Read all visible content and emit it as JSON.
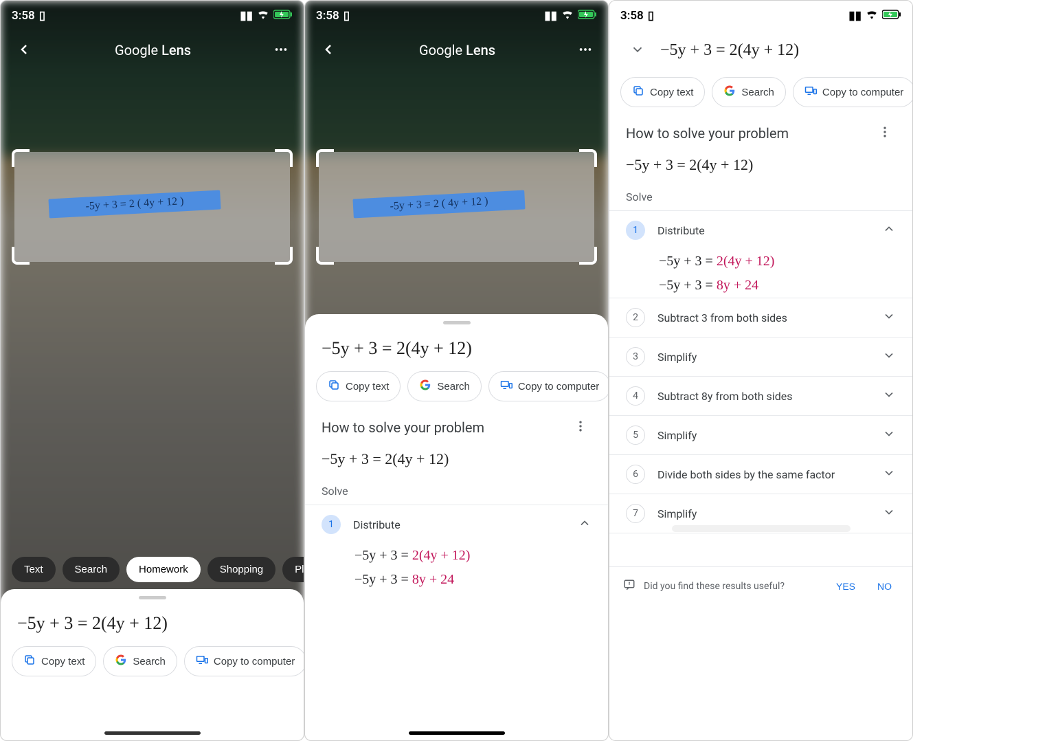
{
  "status": {
    "time": "3:58"
  },
  "lens": {
    "title_prefix": "Google ",
    "title_suffix": "Lens",
    "handwritten": "-5y + 3 = 2 ( 4y + 12 )"
  },
  "categories": [
    "Text",
    "Search",
    "Homework",
    "Shopping",
    "Places"
  ],
  "equation_main": "−5y + 3 = 2(4y + 12)",
  "actions": {
    "copy_text": "Copy text",
    "search": "Search",
    "copy_computer": "Copy to computer"
  },
  "solve": {
    "title": "How to solve your problem",
    "equation": "−5y + 3 = 2(4y + 12)",
    "label": "Solve",
    "steps": [
      {
        "n": 1,
        "title": "Distribute",
        "expanded": true,
        "lines": [
          {
            "pre": "−5y + 3 = ",
            "hl": "2(4y + 12)"
          },
          {
            "pre": "−5y + 3 = ",
            "hl": "8y + 24"
          }
        ]
      },
      {
        "n": 2,
        "title": "Subtract 3 from both sides"
      },
      {
        "n": 3,
        "title": "Simplify"
      },
      {
        "n": 4,
        "title": "Subtract 8y from both sides"
      },
      {
        "n": 5,
        "title": "Simplify"
      },
      {
        "n": 6,
        "title": "Divide both sides by the same factor"
      },
      {
        "n": 7,
        "title": "Simplify"
      }
    ]
  },
  "feedback": {
    "prompt": "Did you find these results useful?",
    "yes": "YES",
    "no": "NO"
  }
}
